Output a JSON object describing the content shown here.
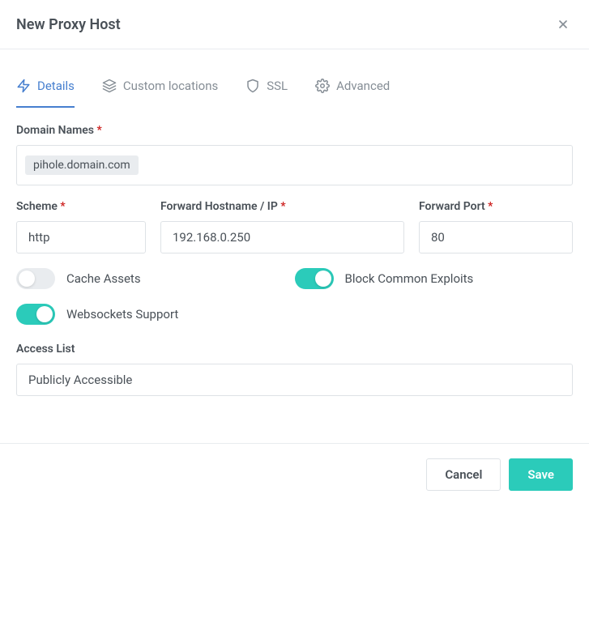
{
  "modal": {
    "title": "New Proxy Host"
  },
  "tabs": {
    "details": "Details",
    "custom_locations": "Custom locations",
    "ssl": "SSL",
    "advanced": "Advanced"
  },
  "labels": {
    "domain_names": "Domain Names",
    "scheme": "Scheme",
    "forward_hostname": "Forward Hostname / IP",
    "forward_port": "Forward Port",
    "access_list": "Access List"
  },
  "values": {
    "domain_tag": "pihole.domain.com",
    "scheme": "http",
    "forward_hostname": "192.168.0.250",
    "forward_port": "80",
    "access_list": "Publicly Accessible"
  },
  "toggles": {
    "cache_assets": {
      "label": "Cache Assets",
      "on": false
    },
    "block_exploits": {
      "label": "Block Common Exploits",
      "on": true
    },
    "websockets": {
      "label": "Websockets Support",
      "on": true
    }
  },
  "buttons": {
    "cancel": "Cancel",
    "save": "Save"
  }
}
